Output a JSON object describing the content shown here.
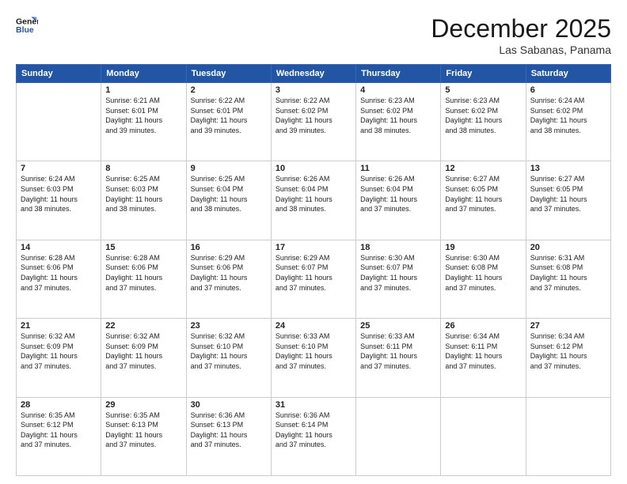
{
  "header": {
    "logo_line1": "General",
    "logo_line2": "Blue",
    "month": "December 2025",
    "location": "Las Sabanas, Panama"
  },
  "weekdays": [
    "Sunday",
    "Monday",
    "Tuesday",
    "Wednesday",
    "Thursday",
    "Friday",
    "Saturday"
  ],
  "weeks": [
    [
      {
        "day": "",
        "info": ""
      },
      {
        "day": "1",
        "info": "Sunrise: 6:21 AM\nSunset: 6:01 PM\nDaylight: 11 hours\nand 39 minutes."
      },
      {
        "day": "2",
        "info": "Sunrise: 6:22 AM\nSunset: 6:01 PM\nDaylight: 11 hours\nand 39 minutes."
      },
      {
        "day": "3",
        "info": "Sunrise: 6:22 AM\nSunset: 6:02 PM\nDaylight: 11 hours\nand 39 minutes."
      },
      {
        "day": "4",
        "info": "Sunrise: 6:23 AM\nSunset: 6:02 PM\nDaylight: 11 hours\nand 38 minutes."
      },
      {
        "day": "5",
        "info": "Sunrise: 6:23 AM\nSunset: 6:02 PM\nDaylight: 11 hours\nand 38 minutes."
      },
      {
        "day": "6",
        "info": "Sunrise: 6:24 AM\nSunset: 6:02 PM\nDaylight: 11 hours\nand 38 minutes."
      }
    ],
    [
      {
        "day": "7",
        "info": "Sunrise: 6:24 AM\nSunset: 6:03 PM\nDaylight: 11 hours\nand 38 minutes."
      },
      {
        "day": "8",
        "info": "Sunrise: 6:25 AM\nSunset: 6:03 PM\nDaylight: 11 hours\nand 38 minutes."
      },
      {
        "day": "9",
        "info": "Sunrise: 6:25 AM\nSunset: 6:04 PM\nDaylight: 11 hours\nand 38 minutes."
      },
      {
        "day": "10",
        "info": "Sunrise: 6:26 AM\nSunset: 6:04 PM\nDaylight: 11 hours\nand 38 minutes."
      },
      {
        "day": "11",
        "info": "Sunrise: 6:26 AM\nSunset: 6:04 PM\nDaylight: 11 hours\nand 37 minutes."
      },
      {
        "day": "12",
        "info": "Sunrise: 6:27 AM\nSunset: 6:05 PM\nDaylight: 11 hours\nand 37 minutes."
      },
      {
        "day": "13",
        "info": "Sunrise: 6:27 AM\nSunset: 6:05 PM\nDaylight: 11 hours\nand 37 minutes."
      }
    ],
    [
      {
        "day": "14",
        "info": "Sunrise: 6:28 AM\nSunset: 6:06 PM\nDaylight: 11 hours\nand 37 minutes."
      },
      {
        "day": "15",
        "info": "Sunrise: 6:28 AM\nSunset: 6:06 PM\nDaylight: 11 hours\nand 37 minutes."
      },
      {
        "day": "16",
        "info": "Sunrise: 6:29 AM\nSunset: 6:06 PM\nDaylight: 11 hours\nand 37 minutes."
      },
      {
        "day": "17",
        "info": "Sunrise: 6:29 AM\nSunset: 6:07 PM\nDaylight: 11 hours\nand 37 minutes."
      },
      {
        "day": "18",
        "info": "Sunrise: 6:30 AM\nSunset: 6:07 PM\nDaylight: 11 hours\nand 37 minutes."
      },
      {
        "day": "19",
        "info": "Sunrise: 6:30 AM\nSunset: 6:08 PM\nDaylight: 11 hours\nand 37 minutes."
      },
      {
        "day": "20",
        "info": "Sunrise: 6:31 AM\nSunset: 6:08 PM\nDaylight: 11 hours\nand 37 minutes."
      }
    ],
    [
      {
        "day": "21",
        "info": "Sunrise: 6:32 AM\nSunset: 6:09 PM\nDaylight: 11 hours\nand 37 minutes."
      },
      {
        "day": "22",
        "info": "Sunrise: 6:32 AM\nSunset: 6:09 PM\nDaylight: 11 hours\nand 37 minutes."
      },
      {
        "day": "23",
        "info": "Sunrise: 6:32 AM\nSunset: 6:10 PM\nDaylight: 11 hours\nand 37 minutes."
      },
      {
        "day": "24",
        "info": "Sunrise: 6:33 AM\nSunset: 6:10 PM\nDaylight: 11 hours\nand 37 minutes."
      },
      {
        "day": "25",
        "info": "Sunrise: 6:33 AM\nSunset: 6:11 PM\nDaylight: 11 hours\nand 37 minutes."
      },
      {
        "day": "26",
        "info": "Sunrise: 6:34 AM\nSunset: 6:11 PM\nDaylight: 11 hours\nand 37 minutes."
      },
      {
        "day": "27",
        "info": "Sunrise: 6:34 AM\nSunset: 6:12 PM\nDaylight: 11 hours\nand 37 minutes."
      }
    ],
    [
      {
        "day": "28",
        "info": "Sunrise: 6:35 AM\nSunset: 6:12 PM\nDaylight: 11 hours\nand 37 minutes."
      },
      {
        "day": "29",
        "info": "Sunrise: 6:35 AM\nSunset: 6:13 PM\nDaylight: 11 hours\nand 37 minutes."
      },
      {
        "day": "30",
        "info": "Sunrise: 6:36 AM\nSunset: 6:13 PM\nDaylight: 11 hours\nand 37 minutes."
      },
      {
        "day": "31",
        "info": "Sunrise: 6:36 AM\nSunset: 6:14 PM\nDaylight: 11 hours\nand 37 minutes."
      },
      {
        "day": "",
        "info": ""
      },
      {
        "day": "",
        "info": ""
      },
      {
        "day": "",
        "info": ""
      }
    ]
  ]
}
